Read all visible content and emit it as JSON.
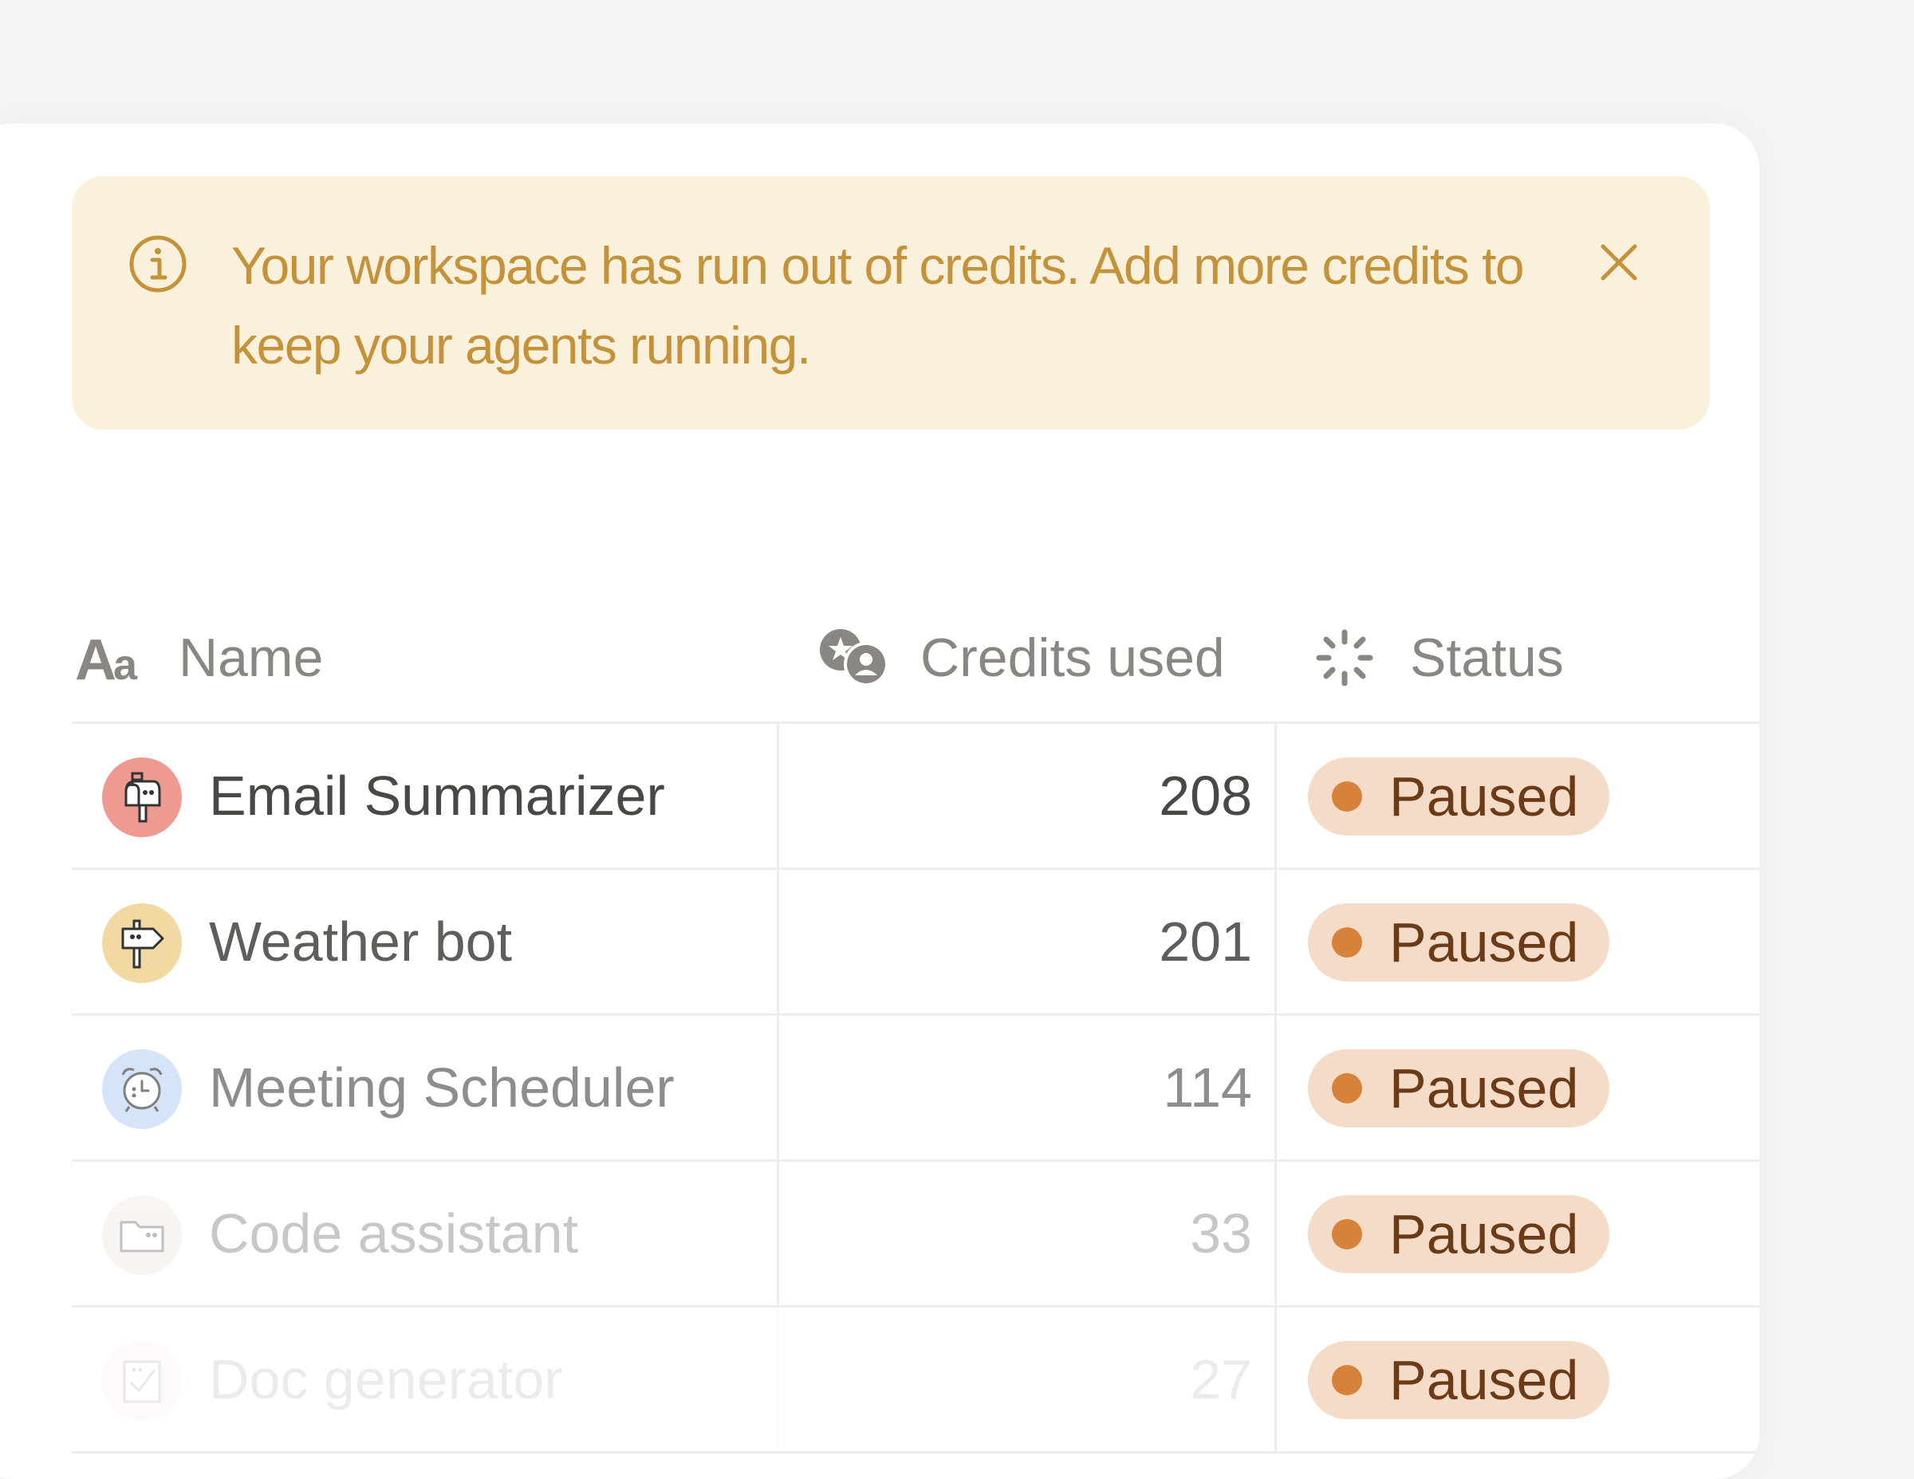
{
  "banner": {
    "message": "Your workspace has run out of credits. Add more credits to keep your agents running.",
    "icon": "info-icon",
    "close_icon": "close-icon",
    "text_color": "#c4923a",
    "background": "#f9f1db"
  },
  "table": {
    "columns": [
      {
        "label": "Name",
        "icon": "text-type-icon"
      },
      {
        "label": "Credits used",
        "icon": "credits-icon"
      },
      {
        "label": "Status",
        "icon": "loading-spinner-icon"
      }
    ],
    "rows": [
      {
        "name": "Email Summarizer",
        "icon": "mailbox-icon",
        "avatar_color": "#ef9a91",
        "credits": "208",
        "status": "Paused"
      },
      {
        "name": "Weather bot",
        "icon": "signpost-icon",
        "avatar_color": "#f2d9a1",
        "credits": "201",
        "status": "Paused"
      },
      {
        "name": "Meeting Scheduler",
        "icon": "alarm-clock-icon",
        "avatar_color": "#bcd5f4",
        "credits": "114",
        "status": "Paused"
      },
      {
        "name": "Code assistant",
        "icon": "folder-icon",
        "avatar_color": "#e8ded6",
        "credits": "33",
        "status": "Paused"
      },
      {
        "name": "Doc generator",
        "icon": "checklist-icon",
        "avatar_color": "#f7d6d3",
        "credits": "27",
        "status": "Paused"
      }
    ]
  },
  "status_colors": {
    "paused_badge": "#f5dcc8",
    "paused_dot": "#d6823a",
    "paused_text": "#6b3a16"
  }
}
